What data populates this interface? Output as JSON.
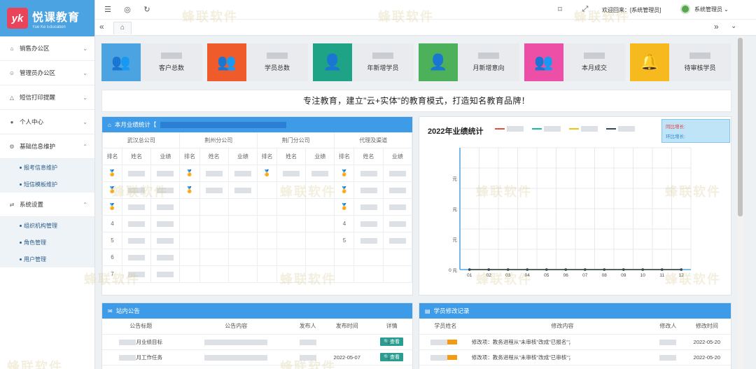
{
  "logo": {
    "mark": "yk",
    "title": "悦课教育",
    "subtitle": "Yue Ke Education"
  },
  "sidebar": {
    "items": [
      {
        "label": "销售办公区",
        "icon": "home-icon"
      },
      {
        "label": "管理员办公区",
        "icon": "user-icon"
      },
      {
        "label": "短信打印提醒",
        "icon": "bell-icon"
      },
      {
        "label": "个人中心",
        "icon": "user-icon"
      },
      {
        "label": "基础信息维护",
        "icon": "gear-icon"
      },
      {
        "label": "系统设置",
        "icon": "gear-icon"
      }
    ],
    "sub_basic": [
      "报考信息维护",
      "短信模板维护"
    ],
    "sub_system": [
      "组织机构管理",
      "角色管理",
      "用户管理"
    ]
  },
  "topbar": {
    "welcome": "欢迎回来：[系统管理员]",
    "admin": "系统管理员"
  },
  "stats": [
    {
      "label": "客户总数",
      "color": "#4ba3e2",
      "icon": "users-icon"
    },
    {
      "label": "学员总数",
      "color": "#f05b2c",
      "icon": "users-icon"
    },
    {
      "label": "年新增学员",
      "color": "#1ea386",
      "icon": "user-add-icon"
    },
    {
      "label": "月新增意向",
      "color": "#4cb15a",
      "icon": "user-add-icon"
    },
    {
      "label": "本月成交",
      "color": "#ee4fa6",
      "icon": "users-icon"
    },
    {
      "label": "待审核学员",
      "color": "#f6b91e",
      "icon": "bell-icon"
    }
  ],
  "banner": "专注教育，建立\"云+实体\"的教育模式，打造知名教育品牌！",
  "performance": {
    "title": "本月业绩统计【",
    "groups": [
      "武汉总公司",
      "荆州分公司",
      "荆门分公司",
      "代理及渠道"
    ],
    "cols": [
      "排名",
      "姓名",
      "业绩"
    ],
    "ranks": [
      "4",
      "5",
      "6",
      "7"
    ]
  },
  "chart_data": {
    "type": "line",
    "title": "2022年业绩统计",
    "categories": [
      "01",
      "02",
      "03",
      "04",
      "05",
      "06",
      "07",
      "08",
      "09",
      "10",
      "11",
      "12"
    ],
    "ytick_zero": "0 元",
    "ytick_unit": "元",
    "tooltip": {
      "r1": "同比增长:",
      "r2": "环比增长:"
    },
    "series": [
      {
        "color": "#e74c3c",
        "values": [
          0.0,
          0.0,
          0.0,
          0.0,
          0.0,
          0.0,
          0.0,
          0.0,
          0.0,
          0.0,
          0.0,
          0.0
        ]
      },
      {
        "color": "#1abc9c",
        "values": [
          0.0,
          0.0,
          0.0,
          0.0,
          0.0,
          0.0,
          0.0,
          0.0,
          0.0,
          0.0,
          0.0,
          0.0
        ]
      },
      {
        "color": "#f1c40f",
        "values": [
          0.0,
          0.0,
          0.0,
          0.0,
          0.0,
          0.0,
          0.0,
          0.0,
          0.0,
          0.0,
          0.0,
          0.0
        ]
      },
      {
        "color": "#34495e",
        "values": [
          0.0,
          0.0,
          0.0,
          0.0,
          0.0,
          0.0,
          0.0,
          0.0,
          0.0,
          0.0,
          0.0,
          0.0
        ]
      }
    ]
  },
  "notice": {
    "title": "站内公告",
    "cols": [
      "公告标题",
      "公告内容",
      "发布人",
      "发布时间",
      "详情"
    ],
    "rows": [
      {
        "title": "月业绩目标",
        "date": "",
        "btn": "查看"
      },
      {
        "title": "月工作任务",
        "date": "2022-05-07",
        "btn": "查看"
      }
    ]
  },
  "records": {
    "title": "学员修改记录",
    "cols": [
      "学员姓名",
      "修改内容",
      "修改人",
      "修改时间"
    ],
    "rows": [
      {
        "content": "修改项：教务进程从\"未审核\"改成\"已报名\"；",
        "time": "2022-05-20"
      },
      {
        "content": "修改项：教务进程从\"未审核\"改成\"已审核\"；",
        "time": "2022-05-20"
      }
    ]
  },
  "watermark": "蜂联软件"
}
